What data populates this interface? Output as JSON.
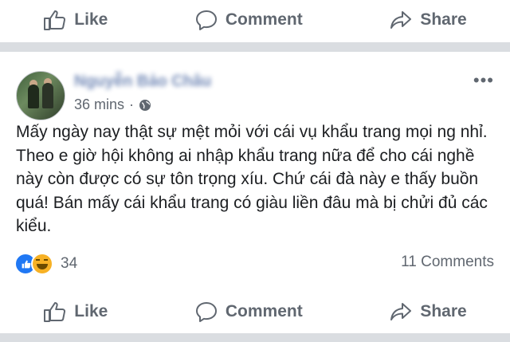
{
  "actions_top": {
    "like": "Like",
    "comment": "Comment",
    "share": "Share"
  },
  "post": {
    "author": "Nguyễn Bảo Châu",
    "time": "36 mins",
    "dot": "·",
    "text": "Mấy ngày nay thật sự mệt mỏi với cái vụ khẩu trang mọi ng nhỉ. Theo e giờ hội không ai nhập khẩu trang nữa để cho cái nghề này còn được có sự tôn trọng xíu. Chứ cái đà này e thấy buồn quá! Bán mấy cái khẩu trang có giàu liền đâu mà bị chửi đủ các kiểu.",
    "more": "•••",
    "reaction_count": "34",
    "comments": "11 Comments"
  },
  "actions_bottom": {
    "like": "Like",
    "comment": "Comment",
    "share": "Share"
  },
  "colors": {
    "link": "#385898",
    "muted": "#606770",
    "like_blue": "#2078f4",
    "haha_yellow": "#f7b125",
    "separator": "#dadde1"
  },
  "icons": [
    "thumbs-up-icon",
    "comment-bubble-icon",
    "share-arrow-icon",
    "globe-icon",
    "more-icon",
    "like-reaction-icon",
    "haha-reaction-icon"
  ]
}
